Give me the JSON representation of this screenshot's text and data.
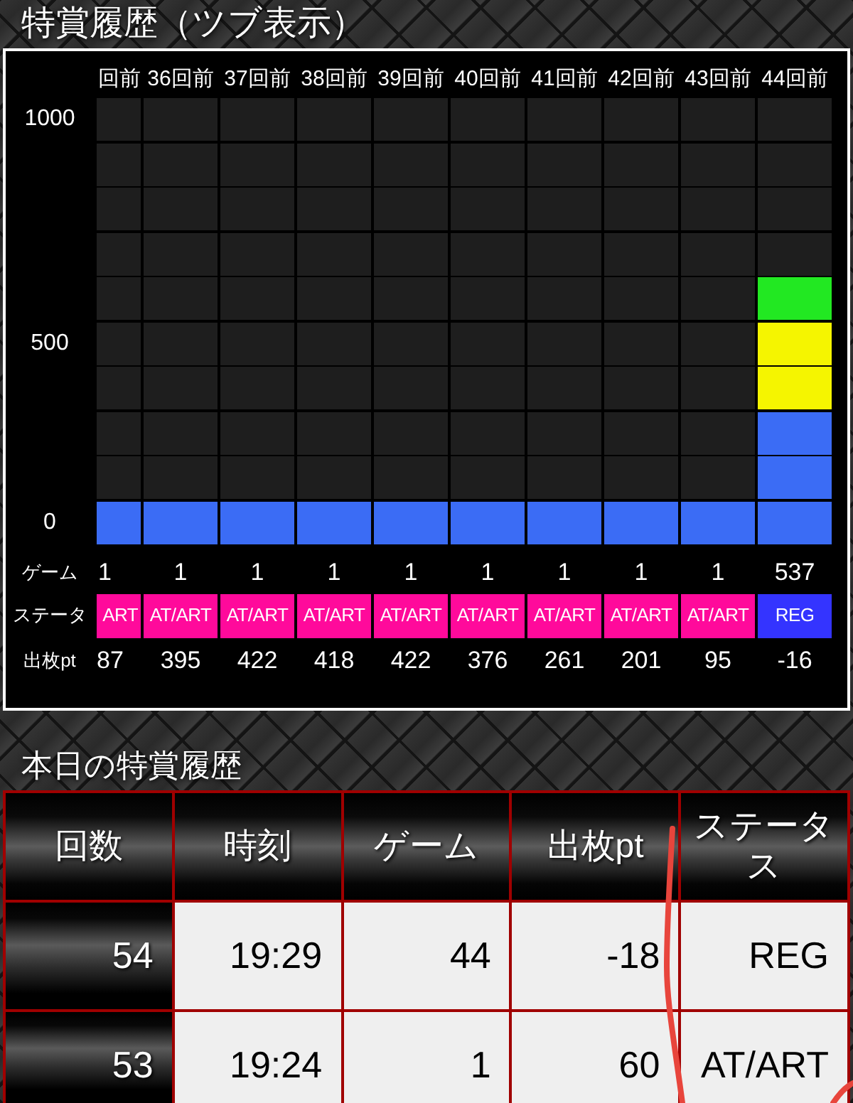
{
  "title": "特賞履歴（ツブ表示）",
  "chart": {
    "y_labels": [
      "1000",
      "500",
      "0"
    ],
    "game_label": "ゲーム",
    "status_label": "ステータ",
    "payout_label": "出枚pt",
    "columns": [
      {
        "kind": "partial",
        "label": "回前",
        "blocks": [
          {
            "color": "#3b6cf5"
          }
        ],
        "game": "1",
        "status": {
          "text": "ART",
          "color": "#ff0a9b"
        },
        "payout": "87"
      },
      {
        "kind": "full",
        "label": "36回前",
        "blocks": [
          {
            "color": "#3b6cf5"
          }
        ],
        "game": "1",
        "status": {
          "text": "AT/ART",
          "color": "#ff0a9b"
        },
        "payout": "395"
      },
      {
        "kind": "full",
        "label": "37回前",
        "blocks": [
          {
            "color": "#3b6cf5"
          }
        ],
        "game": "1",
        "status": {
          "text": "AT/ART",
          "color": "#ff0a9b"
        },
        "payout": "422"
      },
      {
        "kind": "full",
        "label": "38回前",
        "blocks": [
          {
            "color": "#3b6cf5"
          }
        ],
        "game": "1",
        "status": {
          "text": "AT/ART",
          "color": "#ff0a9b"
        },
        "payout": "418"
      },
      {
        "kind": "full",
        "label": "39回前",
        "blocks": [
          {
            "color": "#3b6cf5"
          }
        ],
        "game": "1",
        "status": {
          "text": "AT/ART",
          "color": "#ff0a9b"
        },
        "payout": "422"
      },
      {
        "kind": "full",
        "label": "40回前",
        "blocks": [
          {
            "color": "#3b6cf5"
          }
        ],
        "game": "1",
        "status": {
          "text": "AT/ART",
          "color": "#ff0a9b"
        },
        "payout": "376"
      },
      {
        "kind": "full",
        "label": "41回前",
        "blocks": [
          {
            "color": "#3b6cf5"
          }
        ],
        "game": "1",
        "status": {
          "text": "AT/ART",
          "color": "#ff0a9b"
        },
        "payout": "261"
      },
      {
        "kind": "full",
        "label": "42回前",
        "blocks": [
          {
            "color": "#3b6cf5"
          }
        ],
        "game": "1",
        "status": {
          "text": "AT/ART",
          "color": "#ff0a9b"
        },
        "payout": "201"
      },
      {
        "kind": "full",
        "label": "43回前",
        "blocks": [
          {
            "color": "#3b6cf5"
          }
        ],
        "game": "1",
        "status": {
          "text": "AT/ART",
          "color": "#ff0a9b"
        },
        "payout": "95"
      },
      {
        "kind": "full",
        "label": "44回前",
        "blocks": [
          {
            "color": "#3b6cf5"
          },
          {
            "color": "#3b6cf5"
          },
          {
            "color": "#3b6cf5"
          },
          {
            "color": "#f5f500"
          },
          {
            "color": "#f5f500"
          },
          {
            "color": "#22e822"
          }
        ],
        "game": "537",
        "status": {
          "text": "REG",
          "color": "#3434ff"
        },
        "payout": "-16"
      }
    ]
  },
  "today_history": {
    "title": "本日の特賞履歴",
    "columns": [
      "回数",
      "時刻",
      "ゲーム",
      "出枚pt",
      "ステータス"
    ],
    "rows": [
      [
        "54",
        "19:29",
        "44",
        "-18",
        "REG"
      ],
      [
        "53",
        "19:24",
        "1",
        "60",
        "AT/ART"
      ]
    ]
  }
}
